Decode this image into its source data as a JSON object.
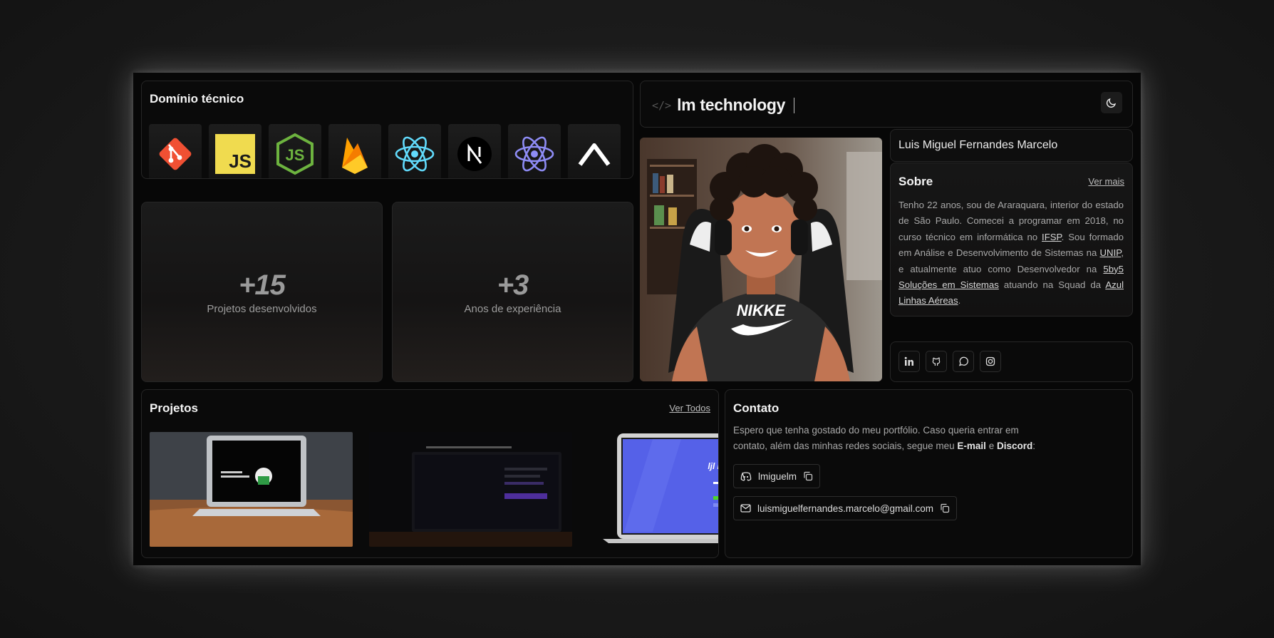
{
  "tech": {
    "title": "Domínio técnico",
    "icons": [
      {
        "name": "git-icon",
        "color": "#F05033"
      },
      {
        "name": "javascript-icon",
        "color": "#F0DB4F"
      },
      {
        "name": "nodejs-icon",
        "color": "#6DB33F"
      },
      {
        "name": "firebase-icon",
        "color": "#FFA000"
      },
      {
        "name": "react-icon",
        "color": "#61DAFB"
      },
      {
        "name": "nextjs-icon",
        "color": "#000000"
      },
      {
        "name": "react-native-icon",
        "color": "#8E8CF5"
      },
      {
        "name": "vite-caret-icon",
        "color": "#FFFFFF"
      }
    ],
    "js_label": "JS"
  },
  "stats": [
    {
      "value": "+15",
      "label": "Projetos desenvolvidos"
    },
    {
      "value": "+3",
      "label": "Anos de experiência"
    }
  ],
  "header": {
    "brand": "lm technology",
    "code_icon": "</>"
  },
  "profile": {
    "name": "Luis Miguel Fernandes Marcelo",
    "shirt_text": "NIKKE"
  },
  "about": {
    "title": "Sobre",
    "more": "Ver mais",
    "p1": "Tenho 22 anos, sou de Araraquara, interior do estado de São Paulo. Comecei a programar em 2018, no curso técnico em informática no ",
    "ifsp": "IFSP",
    "p2": ". Sou formado em Análise e Desenvolvimento de Sistemas na ",
    "unip": "UNIP",
    "p3": ", e atualmente atuo como Desenvolvedor na ",
    "company": "5by5 Soluções em Sistemas",
    "p4": " atuando na Squad da ",
    "client": "Azul Linhas Aéreas",
    "p5": "."
  },
  "social": [
    "linkedin-icon",
    "github-icon",
    "whatsapp-icon",
    "instagram-icon"
  ],
  "projects": {
    "title": "Projetos",
    "view_all": "Ver Todos",
    "third_logo": "ljl move it"
  },
  "contact": {
    "title": "Contato",
    "text1": "Espero que tenha gostado do meu portfólio. Caso queria entrar em contato, além das minhas redes sociais, segue meu ",
    "email_b": "E-mail",
    "and": " e ",
    "discord_b": "Discord",
    "text2": ":",
    "discord": "lmiguelm",
    "email": "luismiguelfernandes.marcelo@gmail.com"
  },
  "colors": {
    "background": "#070707",
    "border": "#262626",
    "accent": "#ffffff"
  }
}
